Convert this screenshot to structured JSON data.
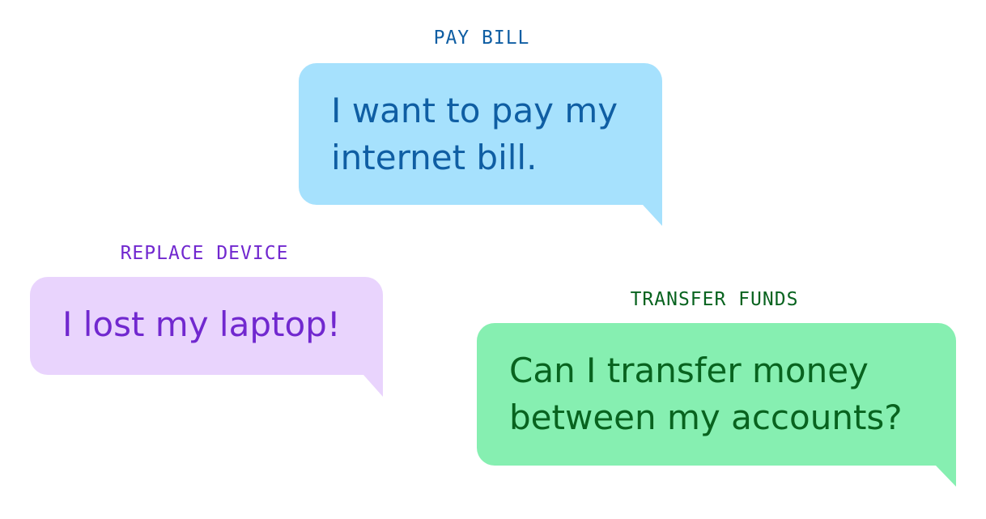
{
  "colors": {
    "pay_bill": {
      "bubble": "#a6e1fd",
      "text": "#0f5ea3"
    },
    "replace_device": {
      "bubble": "#e9d4fd",
      "text": "#7128cf"
    },
    "transfer_funds": {
      "bubble": "#86efb1",
      "text": "#08631f"
    }
  },
  "intents": {
    "pay_bill": {
      "label": "PAY BILL",
      "message": "I want to pay my internet bill."
    },
    "replace_device": {
      "label": "REPLACE DEVICE",
      "message": "I lost my laptop!"
    },
    "transfer_funds": {
      "label": "TRANSFER FUNDS",
      "message": "Can I transfer money between my accounts?"
    }
  }
}
